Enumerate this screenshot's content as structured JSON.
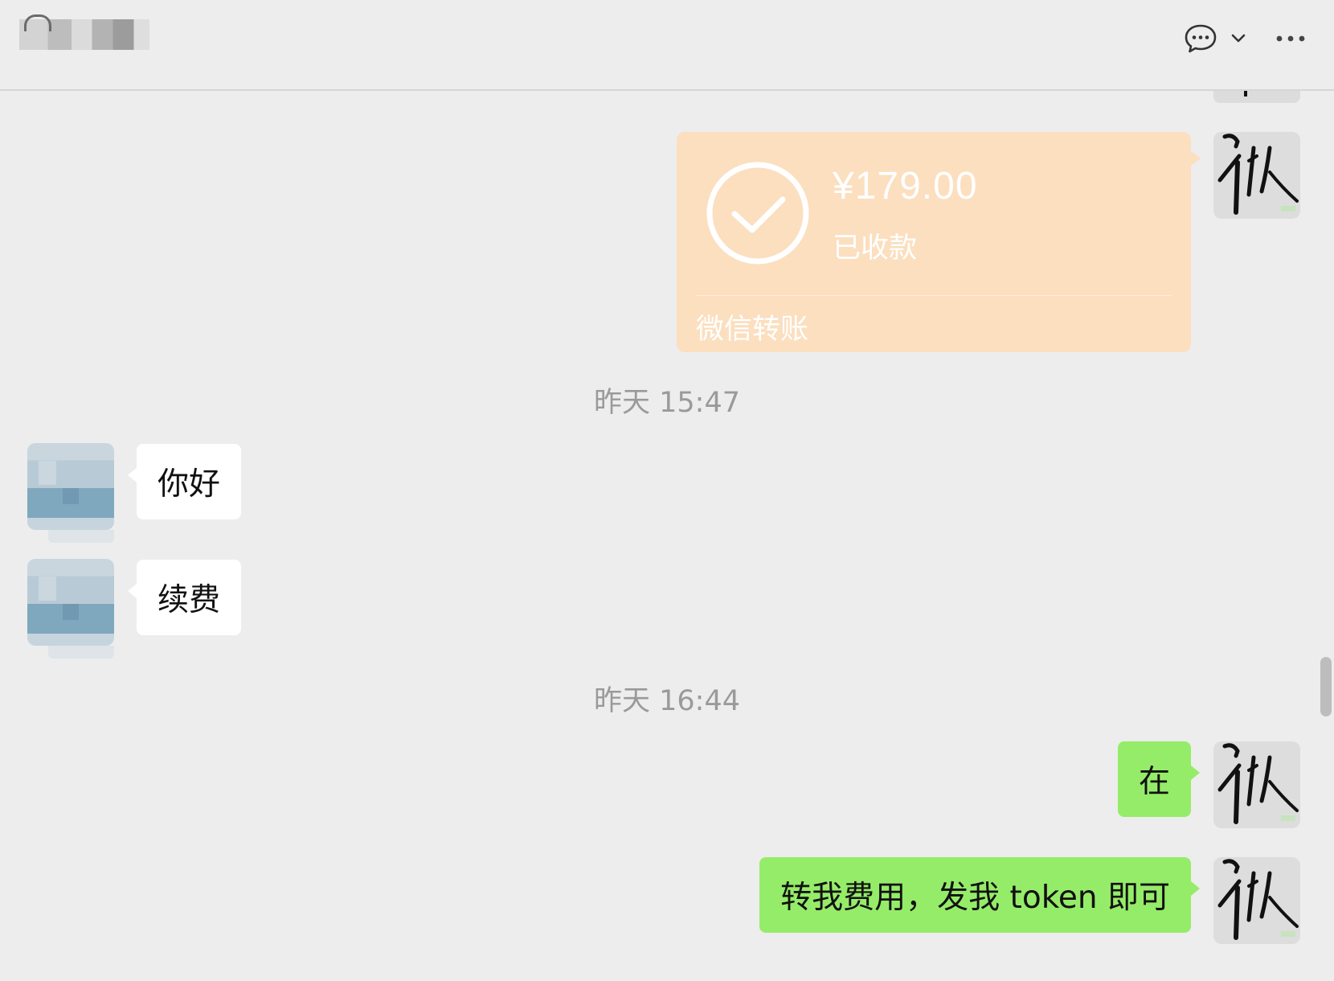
{
  "header": {
    "icons": [
      "chat-bubble-icon",
      "chevron-down-icon",
      "more-icon"
    ]
  },
  "messages": {
    "transfer": {
      "amount": "¥179.00",
      "status": "已收款",
      "label": "微信转账",
      "icon": "check-circle-icon",
      "color": "#fbdfbf"
    },
    "timestamp_1": "昨天 15:47",
    "incoming_1": "你好",
    "incoming_2": "续费",
    "timestamp_2": "昨天 16:44",
    "outgoing_1": "在",
    "outgoing_2": "转我费用，发我 token 即可"
  },
  "colors": {
    "background": "#ededed",
    "incoming_bubble": "#ffffff",
    "outgoing_bubble": "#95ec69",
    "timestamp": "#9a9a9a"
  }
}
